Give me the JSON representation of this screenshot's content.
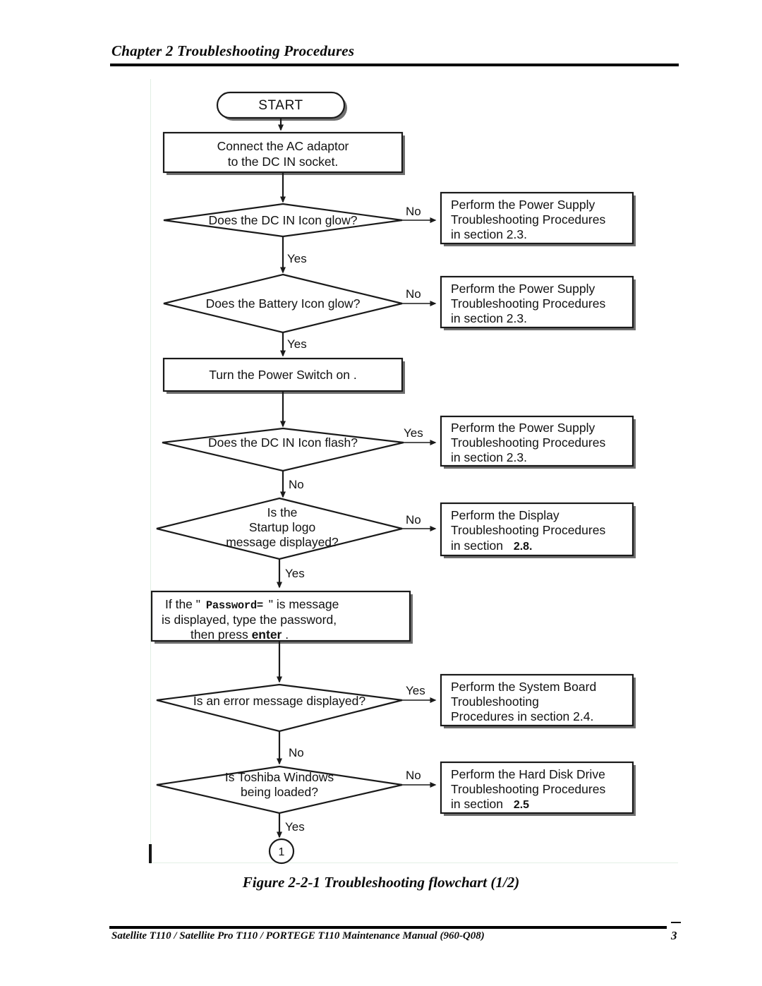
{
  "header": {
    "title": "Chapter 2 Troubleshooting Procedures"
  },
  "figure": {
    "caption": "Figure 2-2-1 Troubleshooting flowchart (1/2)"
  },
  "footer": {
    "manual": "Satellite T110 / Satellite Pro T110 / PORTEGE T110 Maintenance Manual (960-Q08)",
    "page_number": "3"
  },
  "flowchart": {
    "start": {
      "label": "START"
    },
    "nodes": [
      {
        "id": "connect-ac",
        "type": "process",
        "lines": [
          "Connect the AC adaptor",
          "to the DC IN socket."
        ]
      },
      {
        "id": "dc-in-glow",
        "type": "decision",
        "lines": [
          "Does the DC IN Icon glow?"
        ],
        "branch_side": "No",
        "branch_down": "Yes"
      },
      {
        "id": "battery-glow",
        "type": "decision",
        "lines": [
          "Does the Battery Icon glow?"
        ],
        "branch_side": "No",
        "branch_down": "Yes"
      },
      {
        "id": "power-switch",
        "type": "process",
        "lines": [
          "Turn the Power Switch on ."
        ]
      },
      {
        "id": "dc-in-flash",
        "type": "decision",
        "lines": [
          "Does the DC IN Icon flash?"
        ],
        "branch_side": "Yes",
        "branch_down": "No"
      },
      {
        "id": "startup-logo",
        "type": "decision",
        "lines": [
          "Is the",
          "Startup logo",
          "message displayed?"
        ],
        "branch_side": "No",
        "branch_down": "Yes"
      },
      {
        "id": "password-prompt",
        "type": "process",
        "lines": [
          "If the \" Password= \" is message",
          "is displayed, type the password,",
          "then press enter."
        ],
        "mono_fragment": "Password=",
        "bold_fragment": "enter"
      },
      {
        "id": "error-message",
        "type": "decision",
        "lines": [
          "Is an error message displayed?"
        ],
        "branch_side": "Yes",
        "branch_down": "No"
      },
      {
        "id": "toshiba-windows",
        "type": "decision",
        "lines": [
          "Is Toshiba Windows",
          "being loaded?"
        ],
        "branch_side": "No",
        "branch_down": "Yes"
      }
    ],
    "actions": [
      {
        "id": "action-power-1",
        "lines": [
          "Perform the Power Supply",
          "Troubleshooting Procedures",
          "in section 2.3."
        ]
      },
      {
        "id": "action-power-2",
        "lines": [
          "Perform the Power Supply",
          "Troubleshooting Procedures",
          "in section 2.3."
        ]
      },
      {
        "id": "action-power-3",
        "lines": [
          "Perform the Power Supply",
          "Troubleshooting Procedures",
          "in section 2.3."
        ]
      },
      {
        "id": "action-display",
        "lines": [
          "Perform the Display",
          "Troubleshooting Procedures",
          "in section"
        ],
        "section_emph": "2.8."
      },
      {
        "id": "action-system-board",
        "lines": [
          "Perform the System Board",
          "Troubleshooting",
          "Procedures in section 2.4."
        ]
      },
      {
        "id": "action-hdd",
        "lines": [
          "Perform the Hard Disk Drive",
          "Troubleshooting Procedures",
          "in section"
        ],
        "section_emph": "2.5"
      }
    ],
    "connector": {
      "label": "1"
    }
  },
  "text": {
    "t_start_label": "START",
    "n0_l1": "Connect the AC adaptor",
    "n0_l2": "to the DC IN socket.",
    "n1_l1": "Does the DC IN Icon glow?",
    "n1_side": "No",
    "n1_down": "Yes",
    "a0_l1": "Perform the Power Supply",
    "a0_l2": "Troubleshooting Procedures",
    "a0_l3": "in section 2.3.",
    "n2_l1": "Does the Battery Icon glow?",
    "n2_side": "No",
    "n2_down": "Yes",
    "a1_l1": "Perform the Power Supply",
    "a1_l2": "Troubleshooting Procedures",
    "a1_l3": "in section 2.3.",
    "n3_l1": "Turn the Power Switch on .",
    "n4_l1": "Does the DC IN Icon flash?",
    "n4_side": "Yes",
    "n4_down": "No",
    "a2_l1": "Perform the Power Supply",
    "a2_l2": "Troubleshooting Procedures",
    "a2_l3": "in section 2.3.",
    "n5_l1": "Is the",
    "n5_l2": "Startup logo",
    "n5_l3": "message displayed?",
    "n5_side": "No",
    "n5_down": "Yes",
    "a3_l1": "Perform the Display",
    "a3_l2": "Troubleshooting Procedures",
    "a3_l3a": "in section",
    "a3_l3b": "2.8.",
    "n6_l1a": "If the \"",
    "n6_l1b": "Password=",
    "n6_l1c": "\" is message",
    "n6_l2": "is displayed, type the password,",
    "n6_l3a": "then press ",
    "n6_l3b": "enter",
    "n6_l3c": ".",
    "n7_l1": "Is an error message displayed?",
    "n7_side": "Yes",
    "n7_down": "No",
    "a4_l1": "Perform the System Board",
    "a4_l2": "Troubleshooting",
    "a4_l3": "Procedures in section 2.4.",
    "n8_l1": "Is Toshiba Windows",
    "n8_l2": "being loaded?",
    "n8_side": "No",
    "n8_down": "Yes",
    "a5_l1": "Perform the Hard Disk Drive",
    "a5_l2": "Troubleshooting Procedures",
    "a5_l3a": "in section",
    "a5_l3b": "2.5",
    "conn_label": "1"
  }
}
